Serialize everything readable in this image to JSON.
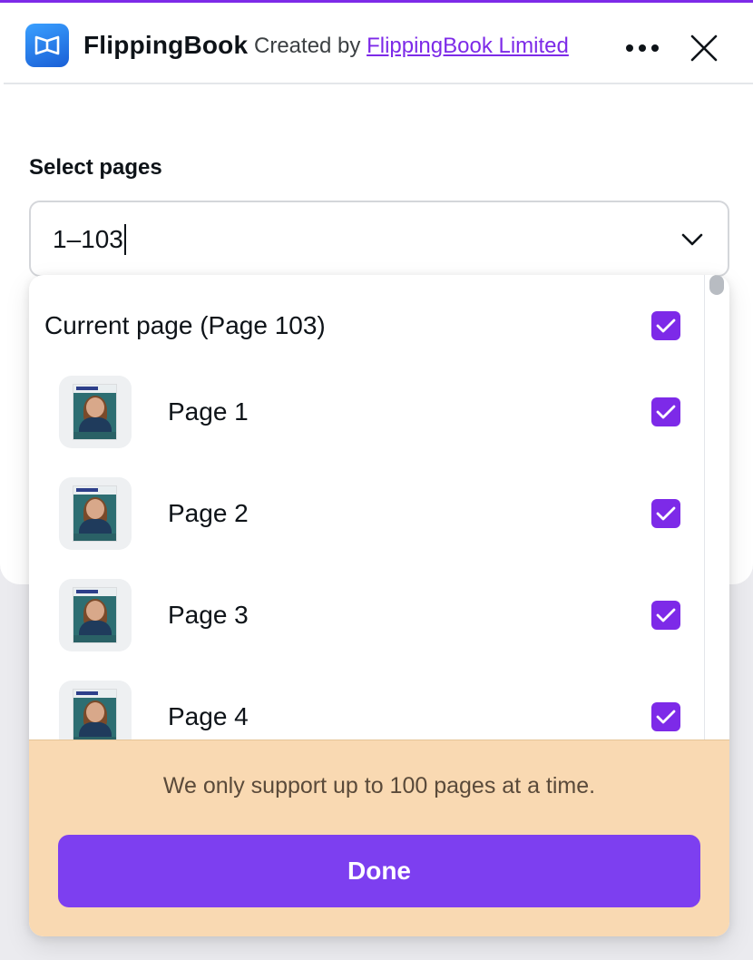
{
  "header": {
    "app_name": "FlippingBook",
    "created_by_prefix": "Created by",
    "developer_link": "FlippingBook Limited",
    "icons": {
      "app": "flippingbook-logo-icon",
      "more": "more-options-icon",
      "close": "close-icon"
    }
  },
  "page_selector": {
    "label": "Select pages",
    "value": "1–103",
    "dropdown_icon": "chevron-down-icon"
  },
  "dropdown": {
    "current_page": {
      "label": "Current page (Page 103)",
      "checked": true
    },
    "pages": [
      {
        "label": "Page 1",
        "checked": true
      },
      {
        "label": "Page 2",
        "checked": true
      },
      {
        "label": "Page 3",
        "checked": true
      },
      {
        "label": "Page 4",
        "checked": true
      }
    ],
    "notice": "We only support up to 100 pages at a time.",
    "done_label": "Done"
  },
  "colors": {
    "accent": "#7d2ae8",
    "done_button": "#7d3ff0",
    "notice_background": "#f9d9b2"
  }
}
